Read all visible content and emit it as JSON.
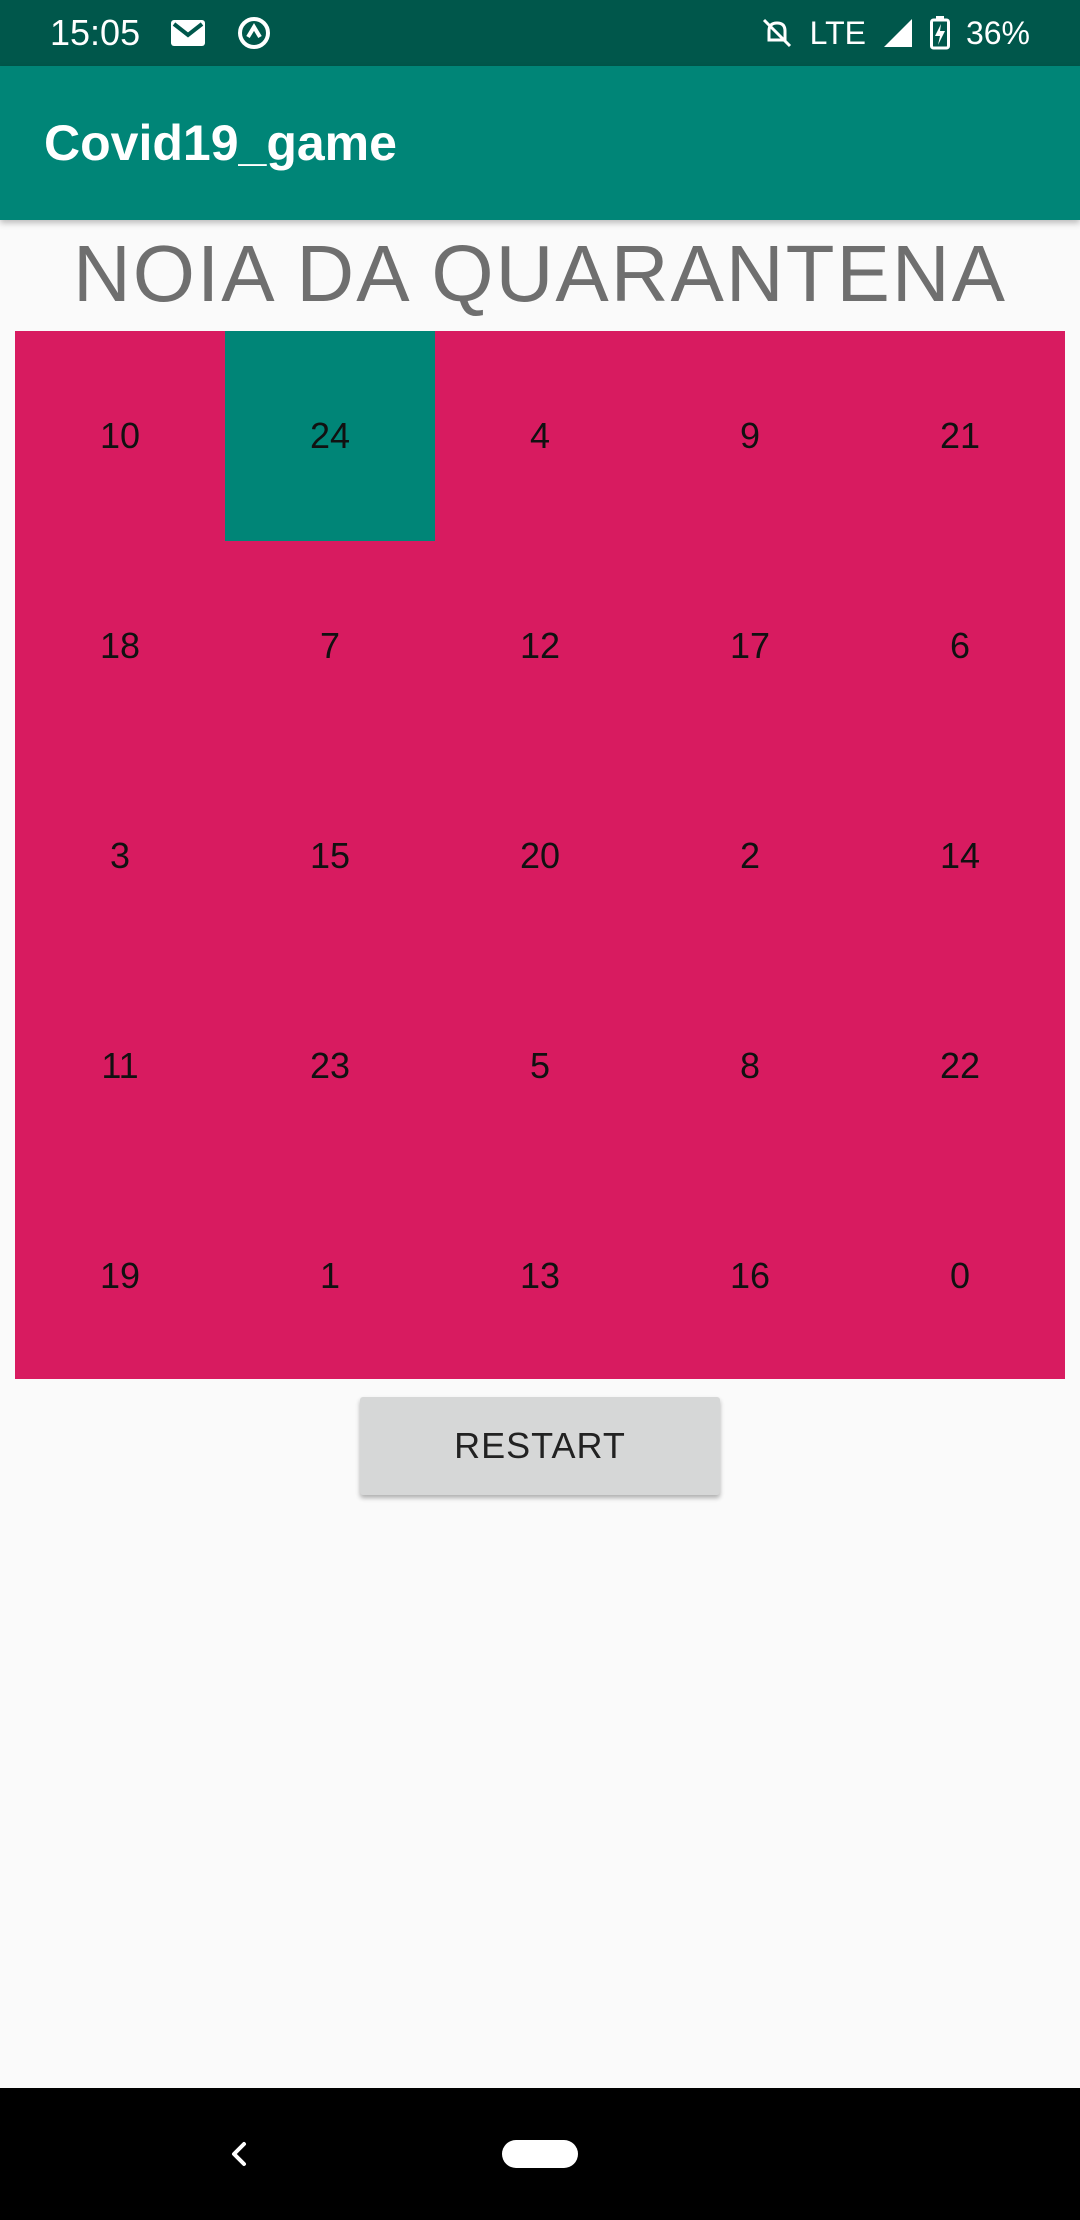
{
  "status_bar": {
    "time": "15:05",
    "network": "LTE",
    "battery": "36%",
    "icons": [
      "gmail-icon",
      "sync-icon",
      "mute-icon",
      "signal-icon",
      "battery-icon"
    ]
  },
  "app_bar": {
    "title": "Covid19_game"
  },
  "game": {
    "title": "NOIA DA QUARANTENA",
    "colors": {
      "tile": "#d81b60",
      "highlight": "#008577"
    },
    "highlighted_value": "24",
    "cells": [
      "10",
      "24",
      "4",
      "9",
      "21",
      "18",
      "7",
      "12",
      "17",
      "6",
      "3",
      "15",
      "20",
      "2",
      "14",
      "11",
      "23",
      "5",
      "8",
      "22",
      "19",
      "1",
      "13",
      "16",
      "0"
    ],
    "restart_label": "RESTART"
  },
  "nav_bar": {
    "icons": [
      "back-icon",
      "home-icon"
    ]
  }
}
